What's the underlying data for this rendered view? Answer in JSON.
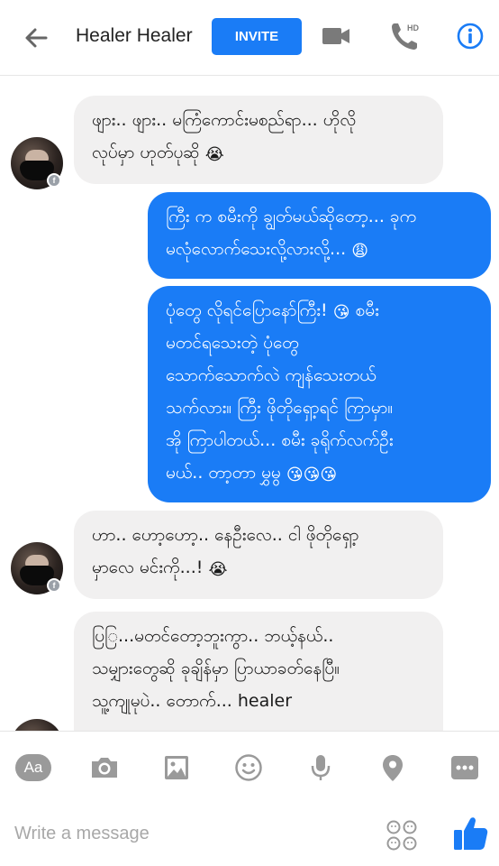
{
  "header": {
    "title": "Healer Healer",
    "invite_label": "INVITE",
    "video_icon": "video-camera-icon",
    "call_icon": "hd-phone-icon",
    "info_icon": "info-icon",
    "back_icon": "back-arrow-icon"
  },
  "messages": [
    {
      "from": "them",
      "line1": "ဖျား.. ဖျား.. မကြံကောင်းမစည်ရာ... ဟိုလို",
      "line2": "လုပ်မှာ ဟုတ်ပုဆို",
      "emoji": "😭"
    },
    {
      "from": "me",
      "line1": "ကြီး က စမီးကို ချွတ်မယ်ဆိုတော့... ခုက",
      "line2": "မလုံလောက်သေးလို့လားလို့...",
      "emoji": "😩"
    },
    {
      "from": "me",
      "line1": "ပုံတွေ လိုရင်ပြောနော်ကြီး!",
      "line1_emoji": "😘",
      "line1_tail": "စမီး",
      "line2": "မတင်ရသေးတဲ့ ပုံတွေ",
      "line3": "သောက်သောက်လဲ ကျန်သေးတယ်",
      "line4": "သက်လား။ ကြီး ဖိုတိုရှော့ရင် ကြာမှာ။",
      "line5": "အို ကြာပါတယ်... စမီး ခုရိုက်လက်ဦး",
      "line6": "မယ်.. တာ့တာ မွှမွ",
      "emoji": "😘😘😘"
    },
    {
      "from": "them",
      "line1": "ဟာ.. ဟော့ဟော့.. နေဦးလေ.. ငါ ဖိုတိုရှော့",
      "line2": "မှာလေ မင်းကို...!",
      "emoji": "😭"
    },
    {
      "from": "them",
      "line1": "ပြြ...မတင်တော့ဘူးကွာ.. ဘယ့်နယ်..",
      "line2": "သမျှားတွေဆို ခုချိန်မှာ ပြာယာခတ်နေပြီ။",
      "line3": "သူ့ကျုမုပဲ.. တောက်... healer"
    }
  ],
  "toolbar": {
    "text_icon_label": "Aa",
    "camera_icon": "camera-icon",
    "gallery_icon": "image-icon",
    "emoji_icon": "smiley-icon",
    "mic_icon": "microphone-icon",
    "location_icon": "location-pin-icon",
    "more_icon": "more-icon"
  },
  "compose": {
    "placeholder": "Write a message",
    "stickers_icon": "stickers-icon",
    "like_icon": "thumbs-up-icon"
  },
  "colors": {
    "accent": "#1a7cf6",
    "incoming": "#f1f0f0",
    "icon_gray": "#9a9a9a"
  }
}
